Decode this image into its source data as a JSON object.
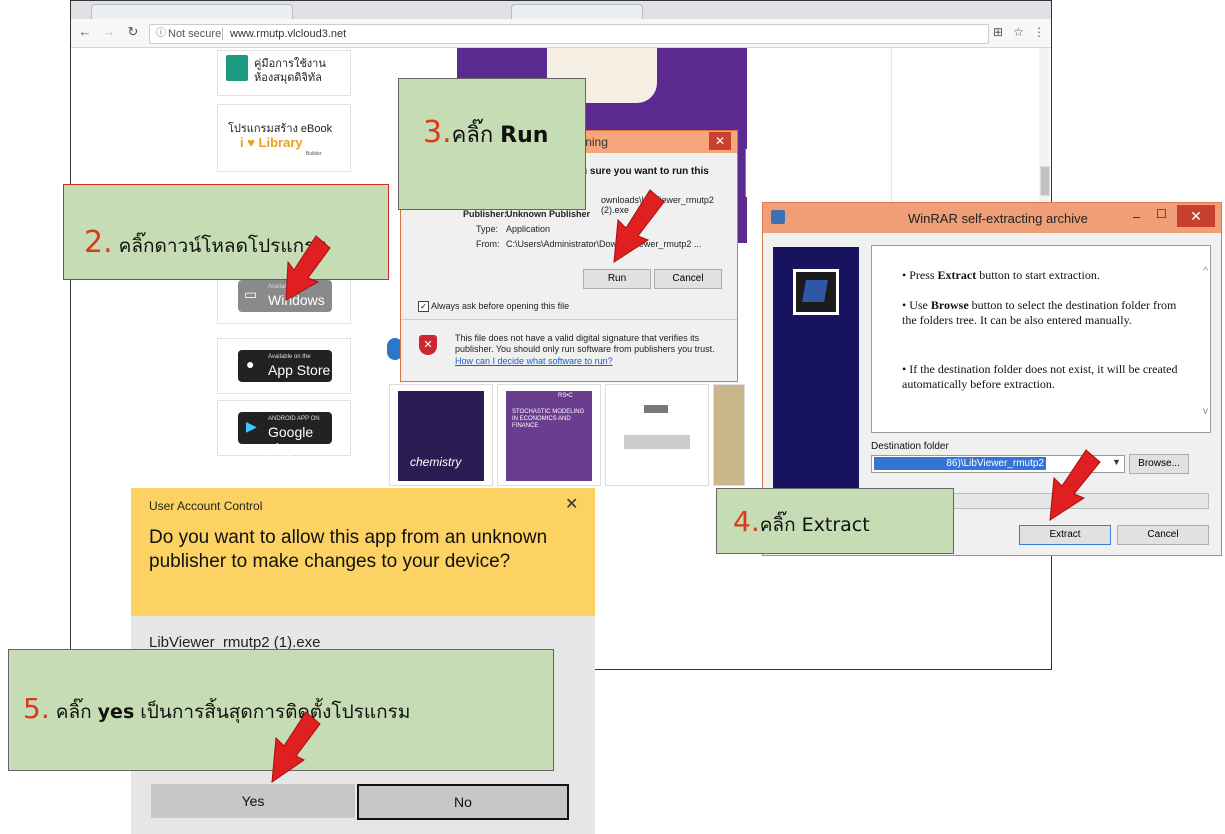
{
  "browser": {
    "security_label": "Not secure",
    "url": "www.rmutp.vlcloud3.net"
  },
  "page": {
    "manual_label": "คู่มือการใช้งาน ห้องสมุดดิจิทัล",
    "ebook_label": "โปรแกรมสร้าง eBook",
    "library_logo": "i ♥ Library",
    "library_sub": "Builder",
    "windows_small": "Available on the",
    "windows_big": "Windows",
    "appstore_small": "Available on the",
    "appstore_big": "App Store",
    "googleplay_small": "ANDROID APP ON",
    "googleplay_big": "Google play",
    "thumb_labels": [
      "chemistry",
      "STOCHASTIC MODELING IN ECONOMICS AND FINANCE",
      "RS•C"
    ]
  },
  "security_warning": {
    "title": "ty Warning",
    "question": "u sure you want to run this",
    "path_fragment": "ownloads\\LibViewer_rmutp2 (2).exe",
    "publisher_label": "Publisher:",
    "publisher_value": "Unknown Publisher",
    "type_label": "Type:",
    "type_value": "Application",
    "from_label": "From:",
    "from_value": "C:\\Users\\Administrator\\Dow...ibViewer_rmutp2 ...",
    "run_label": "Run",
    "cancel_label": "Cancel",
    "always_ask": "Always ask before opening this file",
    "signature_text": "This file does not have a valid digital signature that verifies its publisher. You should only run software from publishers you trust.",
    "help_link": "How can I decide what software to run?"
  },
  "callouts": {
    "step2_num": "2.",
    "step2_text": "คลิ๊กดาวน์โหลดโปรแกรม",
    "step3_num": "3.",
    "step3_text": "คลิ๊ก ",
    "step3_bold": "Run",
    "step4_num": "4.",
    "step4_text": "คลิ๊ก Extract",
    "step5_num": "5.",
    "step5_text": "คลิ๊ก ",
    "step5_bold": "yes",
    "step5_rest": " เป็นการสิ้นสุดการติดตั้งโปรแกรม"
  },
  "winrar": {
    "title": "WinRAR self-extracting archive",
    "bullet1_a": "Press ",
    "bullet1_b": "Extract",
    "bullet1_c": " button to start extraction.",
    "bullet2_a": "Use ",
    "bullet2_b": "Browse",
    "bullet2_c": " button to select the destination folder from the folders tree. It can be also entered manually.",
    "bullet3": "If the destination folder does not exist, it will be created automatically before extraction.",
    "dest_label": "Destination folder",
    "dest_value": "86)\\LibViewer_rmutp2",
    "browse_label": "Browse...",
    "extract_label": "Extract",
    "cancel_label": "Cancel"
  },
  "uac": {
    "header": "User Account Control",
    "question": "Do you want to allow this app from an unknown publisher to make changes to your device?",
    "app_name": "LibViewer_rmutp2 (1).exe",
    "yes_label": "Yes",
    "no_label": "No"
  },
  "colors": {
    "callout_fill": "#c6dcb4",
    "callout_number": "#d93b1a",
    "arrow_red": "#e02020",
    "uac_header": "#fcd262",
    "winrar_title": "#ef9e78",
    "banner_purple": "#5b2a91"
  }
}
